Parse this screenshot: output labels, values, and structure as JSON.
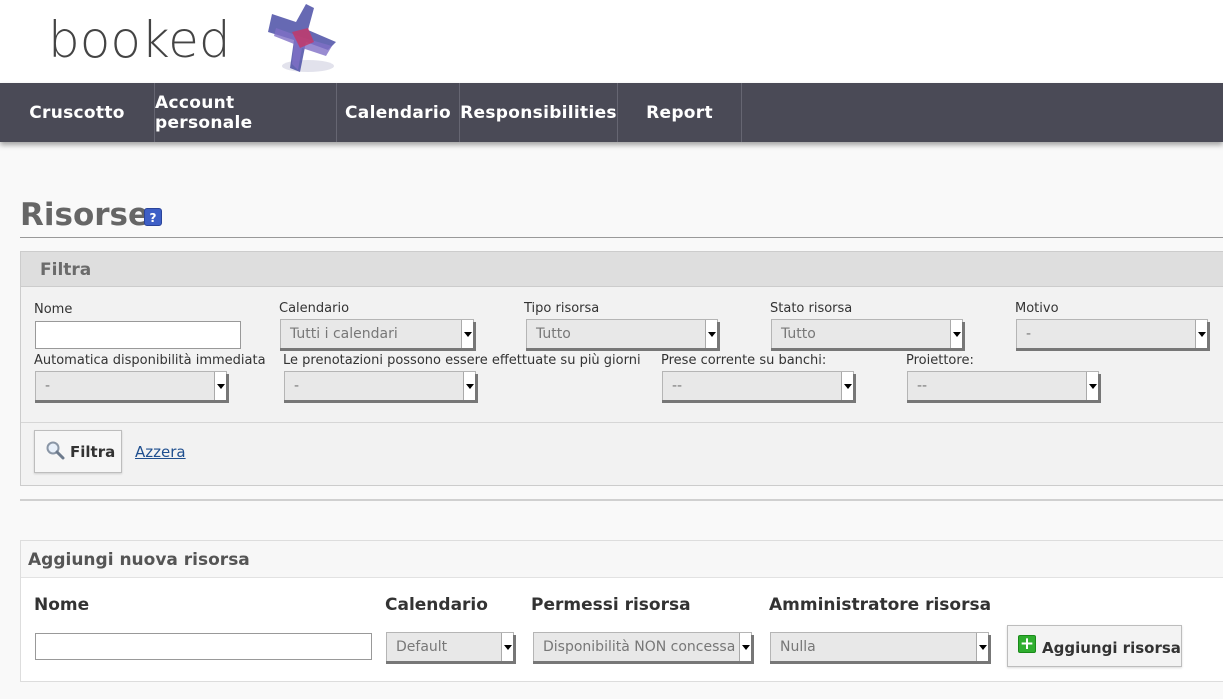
{
  "header": {
    "logo_text": "booked"
  },
  "nav": {
    "items": [
      {
        "label": "Cruscotto"
      },
      {
        "label": "Account personale"
      },
      {
        "label": "Calendario"
      },
      {
        "label": "Responsibilities"
      },
      {
        "label": "Report"
      }
    ]
  },
  "page": {
    "title": "Risorse",
    "help_icon": "?"
  },
  "filter": {
    "title": "Filtra",
    "fields": {
      "name_label": "Nome",
      "name_value": "",
      "calendar_label": "Calendario",
      "calendar_value": "Tutti i calendari",
      "type_label": "Tipo risorsa",
      "type_value": "Tutto",
      "status_label": "Stato risorsa",
      "status_value": "Tutto",
      "reason_label": "Motivo",
      "reason_value": "-",
      "auto_label": "Automatica disponibilità immediata",
      "auto_value": "-",
      "multiday_label": "Le prenotazioni possono essere effettuate su più giorni",
      "multiday_value": "-",
      "power_label": "Prese corrente su banchi:",
      "power_value": "--",
      "projector_label": "Proiettore:",
      "projector_value": "--"
    },
    "filter_button": "Filtra",
    "reset_link": "Azzera"
  },
  "add": {
    "title": "Aggiungi nuova risorsa",
    "name_label": "Nome",
    "name_value": "",
    "calendar_label": "Calendario",
    "calendar_value": "Default",
    "permissions_label": "Permessi risorsa",
    "permissions_value": "Disponibilità NON concessa",
    "admin_label": "Amministratore risorsa",
    "admin_value": "Nulla",
    "add_button": "Aggiungi risorsa"
  },
  "colors": {
    "navbar": "#4a4a56",
    "link": "#1f4f8f",
    "plus": "#2fae2f",
    "help": "#3e5fc6"
  },
  "icons": {
    "help": "help-icon",
    "search": "search-icon",
    "plus": "plus-icon",
    "logo": "logo-mark-icon"
  }
}
